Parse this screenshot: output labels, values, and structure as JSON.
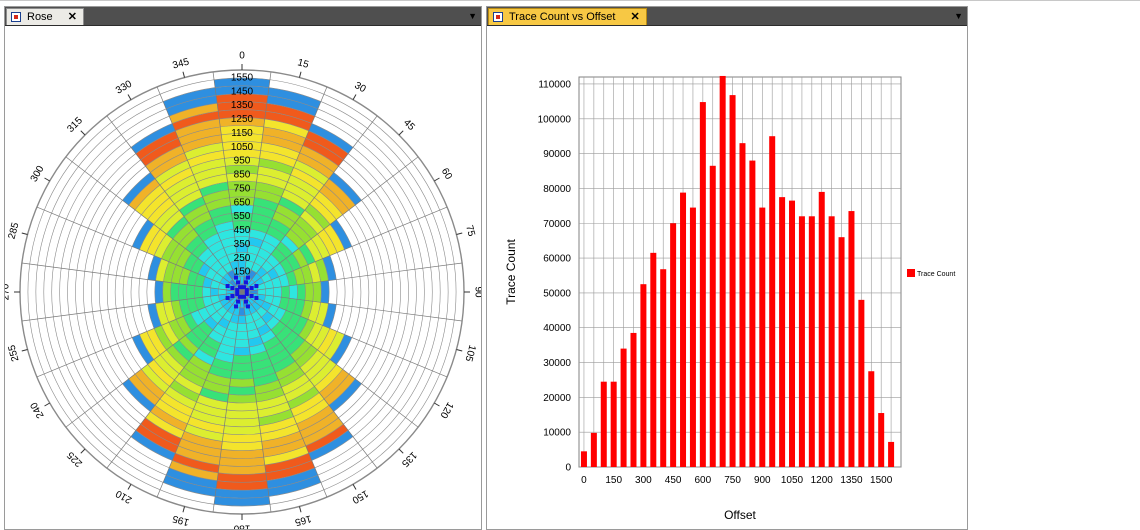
{
  "tabs": {
    "rose": {
      "label": "Rose",
      "close": "✕"
    },
    "trace": {
      "label": "Trace Count vs Offset",
      "close": "✕"
    },
    "dropdown_glyph": "▼"
  },
  "colors": {
    "bar": "#ff0000",
    "rose_scale": [
      "#2e8fe0",
      "#22c8f0",
      "#2ee6e0",
      "#38e278",
      "#96e032",
      "#dcee30",
      "#f4e42c",
      "#f0b228",
      "#f05a1c",
      "#ee1c1c"
    ],
    "rose_center_marker": "#1414dc"
  },
  "chart_data": [
    {
      "type": "polar-rose",
      "title": "",
      "angle_labels": [
        "0",
        "15",
        "30",
        "45",
        "60",
        "75",
        "90",
        "105",
        "120",
        "135",
        "150",
        "165",
        "180",
        "195",
        "210",
        "225",
        "240",
        "255",
        "270",
        "285",
        "300",
        "315",
        "330",
        "345"
      ],
      "radial_labels": [
        "150",
        "250",
        "350",
        "450",
        "550",
        "650",
        "750",
        "850",
        "950",
        "1050",
        "1150",
        "1250",
        "1350",
        "1450",
        "1550"
      ],
      "sectors": 24,
      "rings": 28,
      "radial_max": 1600
    },
    {
      "type": "bar",
      "title": "",
      "xlabel": "Offset",
      "ylabel": "Trace Count",
      "legend": {
        "label": "Trace Count",
        "position": "right"
      },
      "xlim": [
        -25,
        1600
      ],
      "ylim": [
        0,
        112000
      ],
      "x_ticks": [
        0,
        150,
        300,
        450,
        600,
        750,
        900,
        1050,
        1200,
        1350,
        1500
      ],
      "y_ticks": [
        0,
        10000,
        20000,
        30000,
        40000,
        50000,
        60000,
        70000,
        80000,
        90000,
        100000,
        110000
      ],
      "grid": true,
      "x": [
        0,
        50,
        100,
        150,
        200,
        250,
        300,
        350,
        400,
        450,
        500,
        550,
        600,
        650,
        700,
        750,
        800,
        850,
        900,
        950,
        1000,
        1050,
        1100,
        1150,
        1200,
        1250,
        1300,
        1350,
        1400,
        1450,
        1500,
        1550
      ],
      "values": [
        4500,
        9800,
        24500,
        24500,
        34000,
        38500,
        52500,
        61500,
        56800,
        70000,
        78800,
        74500,
        104800,
        86500,
        112300,
        106800,
        93000,
        88000,
        74500,
        95000,
        77500,
        76500,
        72000,
        72000,
        79000,
        72000,
        66000,
        73500,
        48000,
        27500,
        15500,
        7200
      ]
    }
  ]
}
